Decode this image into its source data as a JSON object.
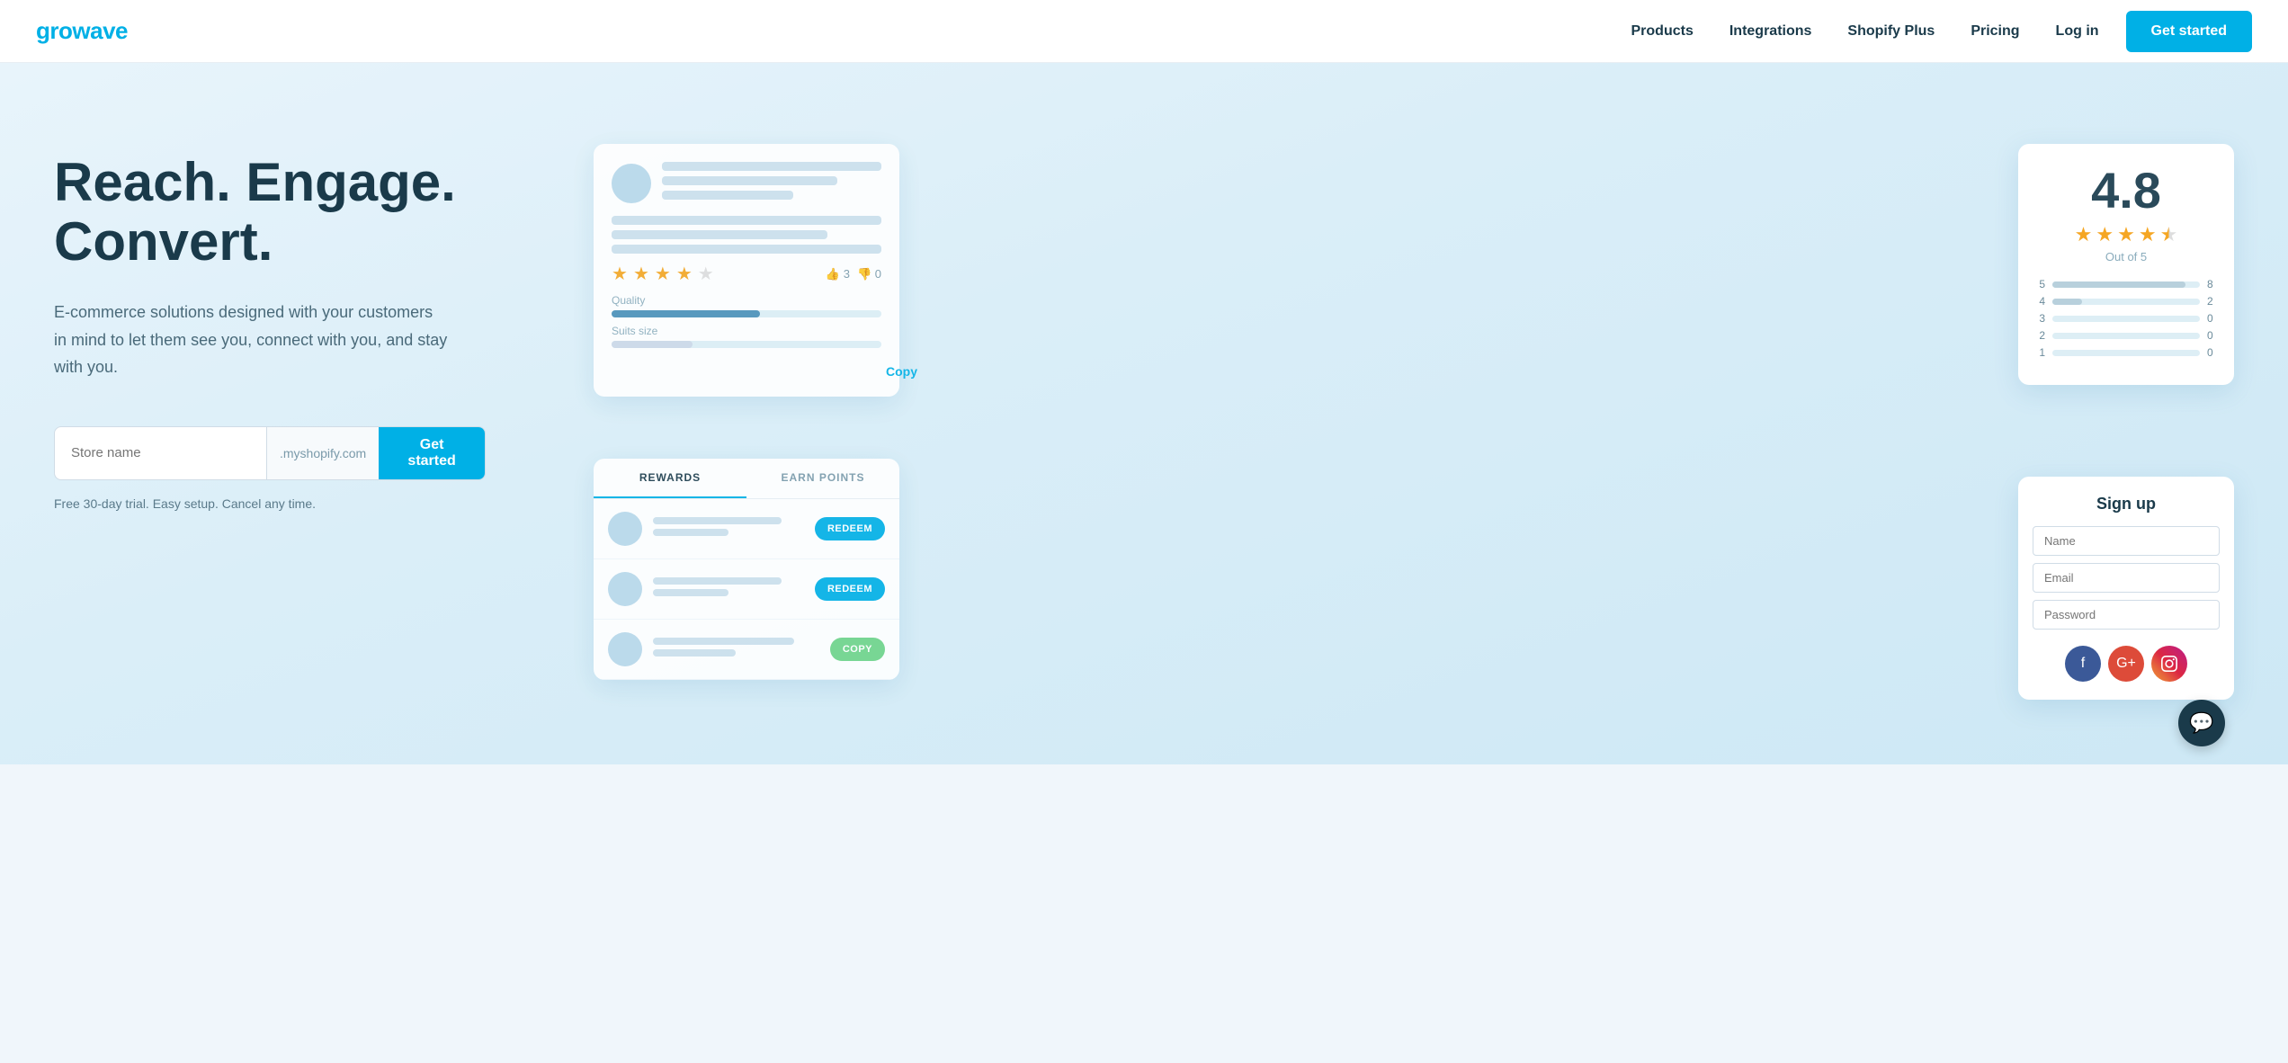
{
  "navbar": {
    "logo_prefix": "gro",
    "logo_w": "w",
    "logo_suffix": "ave",
    "nav_items": [
      {
        "label": "Products",
        "id": "products"
      },
      {
        "label": "Integrations",
        "id": "integrations"
      },
      {
        "label": "Shopify Plus",
        "id": "shopify-plus"
      },
      {
        "label": "Pricing",
        "id": "pricing"
      },
      {
        "label": "Log in",
        "id": "login"
      }
    ],
    "cta_label": "Get started"
  },
  "hero": {
    "heading": "Reach. Engage. Convert.",
    "subtext": "E-commerce solutions designed with your customers in mind to let them see you, connect with you, and stay with you.",
    "store_placeholder": "Store name",
    "store_suffix": ".myshopify.com",
    "cta_label": "Get started",
    "trial_text": "Free 30-day trial. Easy setup. Cancel any time."
  },
  "rating_widget": {
    "big_number": "4.8",
    "stars": 4,
    "half_star": true,
    "out_of": "Out of 5",
    "bars": [
      {
        "label": "5",
        "width": 90,
        "count": "8"
      },
      {
        "label": "4",
        "width": 20,
        "count": "2"
      },
      {
        "label": "3",
        "width": 0,
        "count": "0"
      },
      {
        "label": "2",
        "width": 0,
        "count": "0"
      },
      {
        "label": "1",
        "width": 0,
        "count": "0"
      }
    ]
  },
  "review_widget": {
    "stars_count": 4,
    "thumbs_up": "3",
    "thumbs_down": "0",
    "quality_label": "Quality",
    "suits_size_label": "Suits size",
    "copy_label": "Copy"
  },
  "rewards_widget": {
    "tab1": "REWARDS",
    "tab2": "EARN POINTS",
    "items": [
      {
        "redeem_label": "REDEEM"
      },
      {
        "redeem_label": "REDEEM"
      },
      {
        "copy_label": "COPY"
      }
    ]
  },
  "signup_widget": {
    "title": "Sign up",
    "name_placeholder": "Name",
    "email_placeholder": "Email",
    "password_placeholder": "Password"
  },
  "colors": {
    "brand_blue": "#00b0e6",
    "dark": "#1a3a4a",
    "star_gold": "#f5a623"
  }
}
